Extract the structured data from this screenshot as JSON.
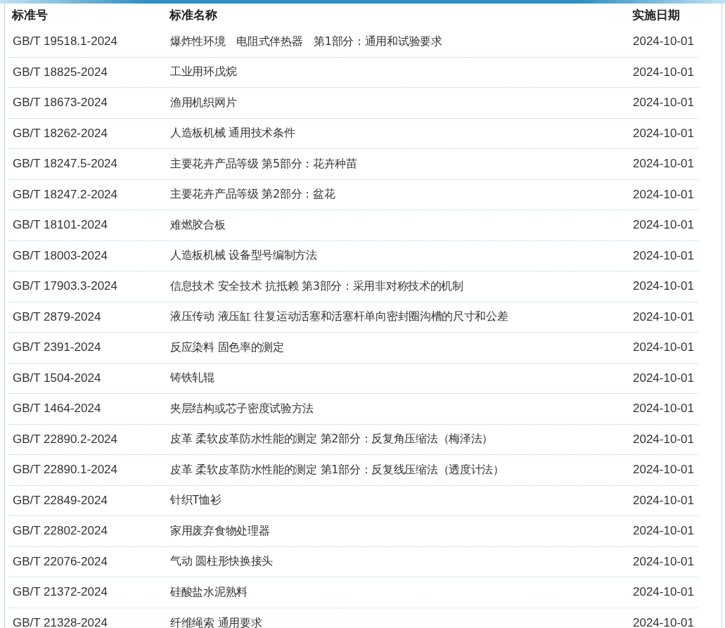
{
  "table": {
    "columns": [
      "标准号",
      "标准名称",
      "实施日期"
    ],
    "rows": [
      [
        "GB/T 19518.1-2024",
        "爆炸性环境　电阻式伴热器　第1部分：通用和试验要求",
        "2024-10-01"
      ],
      [
        "GB/T 18825-2024",
        "工业用环戊烷",
        "2024-10-01"
      ],
      [
        "GB/T 18673-2024",
        "渔用机织网片",
        "2024-10-01"
      ],
      [
        "GB/T 18262-2024",
        "人造板机械 通用技术条件",
        "2024-10-01"
      ],
      [
        "GB/T 18247.5-2024",
        "主要花卉产品等级 第5部分：花卉种苗",
        "2024-10-01"
      ],
      [
        "GB/T 18247.2-2024",
        "主要花卉产品等级 第2部分：盆花",
        "2024-10-01"
      ],
      [
        "GB/T 18101-2024",
        "难燃胶合板",
        "2024-10-01"
      ],
      [
        "GB/T 18003-2024",
        "人造板机械 设备型号编制方法",
        "2024-10-01"
      ],
      [
        "GB/T 17903.3-2024",
        "信息技术 安全技术 抗抵赖 第3部分：采用非对称技术的机制",
        "2024-10-01"
      ],
      [
        "GB/T 2879-2024",
        "液压传动 液压缸 往复运动活塞和活塞杆单向密封圈沟槽的尺寸和公差",
        "2024-10-01"
      ],
      [
        "GB/T 2391-2024",
        "反应染料 固色率的测定",
        "2024-10-01"
      ],
      [
        "GB/T 1504-2024",
        "铸铁轧辊",
        "2024-10-01"
      ],
      [
        "GB/T 1464-2024",
        "夹层结构或芯子密度试验方法",
        "2024-10-01"
      ],
      [
        "GB/T 22890.2-2024",
        "皮革 柔软皮革防水性能的测定 第2部分：反复角压缩法（梅泽法）",
        "2024-10-01"
      ],
      [
        "GB/T 22890.1-2024",
        "皮革 柔软皮革防水性能的测定 第1部分：反复线压缩法（透度计法）",
        "2024-10-01"
      ],
      [
        "GB/T 22849-2024",
        "针织T恤衫",
        "2024-10-01"
      ],
      [
        "GB/T 22802-2024",
        "家用废弃食物处理器",
        "2024-10-01"
      ],
      [
        "GB/T 22076-2024",
        "气动 圆柱形快换接头",
        "2024-10-01"
      ],
      [
        "GB/T 21372-2024",
        "硅酸盐水泥熟料",
        "2024-10-01"
      ],
      [
        "GB/T 21328-2024",
        "纤维绳索 通用要求",
        "2024-10-01"
      ]
    ]
  }
}
